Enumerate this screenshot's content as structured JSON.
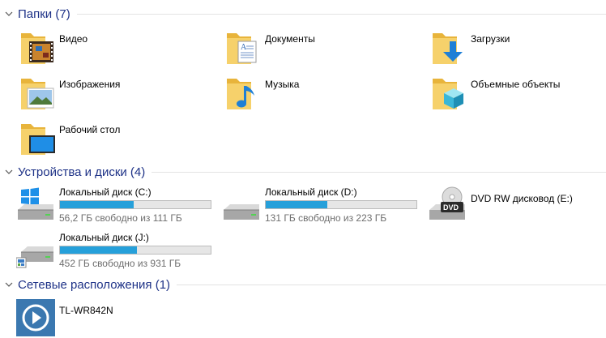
{
  "groups": {
    "folders": {
      "title": "Папки (7)",
      "items": [
        {
          "label": "Видео",
          "icon": "video-folder-icon"
        },
        {
          "label": "Документы",
          "icon": "documents-folder-icon"
        },
        {
          "label": "Загрузки",
          "icon": "downloads-folder-icon"
        },
        {
          "label": "Изображения",
          "icon": "pictures-folder-icon"
        },
        {
          "label": "Музыка",
          "icon": "music-folder-icon"
        },
        {
          "label": "Объемные объекты",
          "icon": "3d-objects-folder-icon"
        },
        {
          "label": "Рабочий стол",
          "icon": "desktop-folder-icon"
        }
      ]
    },
    "devices": {
      "title": "Устройства и диски (4)",
      "items": [
        {
          "label": "Локальный диск (C:)",
          "free_text": "56,2 ГБ свободно из 111 ГБ",
          "used_fraction": 0.49,
          "icon": "system-drive-icon"
        },
        {
          "label": "Локальный диск (D:)",
          "free_text": "131 ГБ свободно из 223 ГБ",
          "used_fraction": 0.41,
          "icon": "hard-drive-icon"
        },
        {
          "label": "DVD RW дисковод (E:)",
          "icon": "dvd-drive-icon"
        },
        {
          "label": "Локальный диск (J:)",
          "free_text": "452 ГБ свободно из 931 ГБ",
          "used_fraction": 0.51,
          "icon": "hard-drive-icon"
        }
      ]
    },
    "network": {
      "title": "Сетевые расположения (1)",
      "items": [
        {
          "label": "TL-WR842N",
          "icon": "media-device-icon"
        }
      ]
    }
  },
  "colors": {
    "header_text": "#1e3287",
    "bar_fill": "#26a0da",
    "folder_yellow": "#f2c350"
  }
}
